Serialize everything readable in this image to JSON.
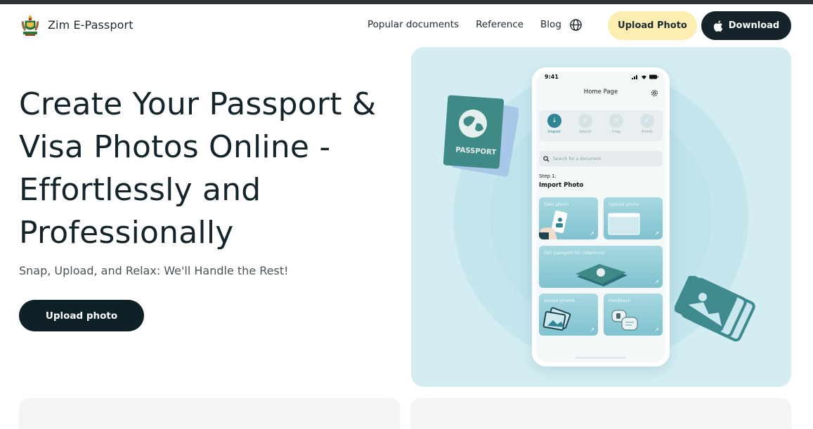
{
  "brand": {
    "name": "Zim E-Passport",
    "logo_icon": "zimbabwe-coat-of-arms-icon"
  },
  "nav": {
    "items": [
      {
        "label": "Popular documents"
      },
      {
        "label": "Reference"
      },
      {
        "label": "Blog"
      }
    ],
    "language_icon": "globe-icon"
  },
  "header_buttons": {
    "upload_label": "Upload Photo",
    "download_label": "Download",
    "download_icon": "apple-icon"
  },
  "hero": {
    "title": "Create Your Passport & Visa Photos Online - Effortlessly and Professionally",
    "subtitle": "Snap, Upload, and Relax: We'll Handle the Rest!",
    "cta_label": "Upload photo"
  },
  "phone": {
    "time": "9:41",
    "title": "Home Page",
    "steps": [
      {
        "label": "Import",
        "active": true
      },
      {
        "label": "Adjust",
        "active": false
      },
      {
        "label": "Crop",
        "active": false
      },
      {
        "label": "Finish",
        "active": false
      }
    ],
    "search_placeholder": "Search for a document",
    "step_number": "Step 1:",
    "step_title": "Import Photo",
    "cards": {
      "take_photo": "Take photo",
      "upload_photo": "Upload photo",
      "reference": "Get passport for reference",
      "saved": "Saved photos",
      "feedback": "Feedback"
    }
  },
  "colors": {
    "dark": "#14242a",
    "accent_yellow": "#fbeeb0",
    "panel_bg": "#d4edf3",
    "teal": "#2f8592"
  }
}
